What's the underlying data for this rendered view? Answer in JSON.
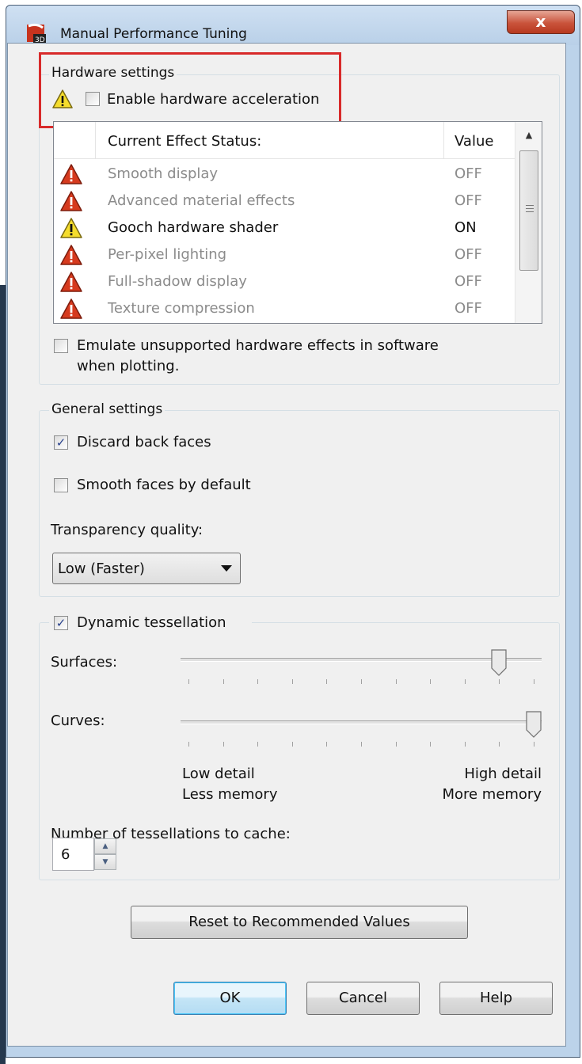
{
  "window": {
    "title": "Manual Performance Tuning",
    "close_label": "x"
  },
  "hardware": {
    "group_label": "Hardware settings",
    "enable_accel_label": "Enable hardware acceleration",
    "enable_accel_checked": false,
    "list_header": {
      "name": "Current Effect Status:",
      "value": "Value"
    },
    "effects": [
      {
        "name": "Smooth display",
        "value": "OFF",
        "icon": "error-triangle-icon",
        "enabled": false
      },
      {
        "name": "Advanced material effects",
        "value": "OFF",
        "icon": "error-triangle-icon",
        "enabled": false
      },
      {
        "name": "Gooch hardware shader",
        "value": "ON",
        "icon": "warning-triangle-icon",
        "enabled": true
      },
      {
        "name": "Per-pixel lighting",
        "value": "OFF",
        "icon": "error-triangle-icon",
        "enabled": false
      },
      {
        "name": "Full-shadow display",
        "value": "OFF",
        "icon": "error-triangle-icon",
        "enabled": false
      },
      {
        "name": "Texture compression",
        "value": "OFF",
        "icon": "error-triangle-icon",
        "enabled": false
      }
    ],
    "emulate_label_line1": "Emulate unsupported hardware effects in software",
    "emulate_label_line2": "when plotting.",
    "emulate_checked": false
  },
  "general": {
    "group_label": "General settings",
    "discard_back_faces_label": "Discard back faces",
    "discard_back_faces_checked": true,
    "smooth_faces_label": "Smooth faces by default",
    "smooth_faces_checked": false,
    "transparency_label": "Transparency quality:",
    "transparency_value": "Low (Faster)"
  },
  "tessellation": {
    "dynamic_label": "Dynamic tessellation",
    "dynamic_checked": true,
    "surfaces_label": "Surfaces:",
    "surfaces_level": 0.9,
    "curves_label": "Curves:",
    "curves_level": 1.0,
    "low_detail_label": "Low detail",
    "less_memory_label": "Less memory",
    "high_detail_label": "High detail",
    "more_memory_label": "More memory",
    "cache_label": "Number of tessellations to cache:",
    "cache_value": "6"
  },
  "buttons": {
    "reset_label": "Reset to Recommended Values",
    "ok_label": "OK",
    "cancel_label": "Cancel",
    "help_label": "Help"
  },
  "colors": {
    "highlight_box": "#d82a2a",
    "error_icon": "#d63a1e",
    "warning_icon": "#f2d21c",
    "disabled_text": "#8b8b8b"
  }
}
